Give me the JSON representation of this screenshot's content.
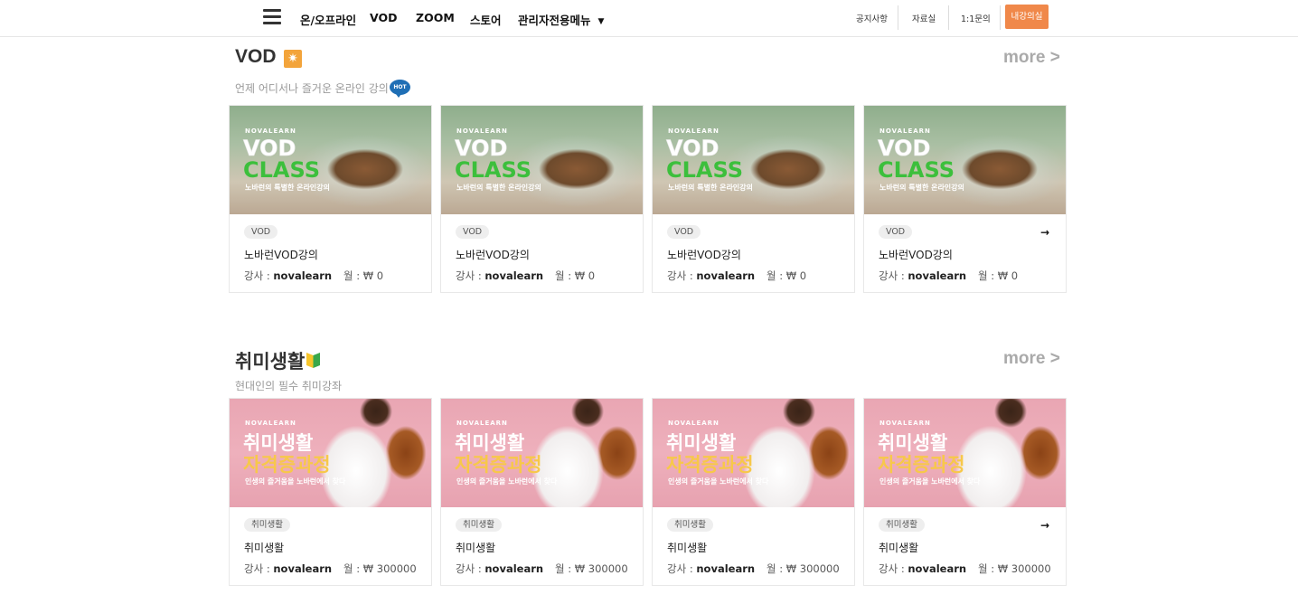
{
  "header": {
    "nav": [
      "온/오프라인",
      "VOD",
      "ZOOM",
      "스토어",
      "관리자전용메뉴"
    ],
    "utils": [
      "공지사항",
      "자료실",
      "1:1문의"
    ],
    "my_label": "내강의실"
  },
  "sections": [
    {
      "title": "VOD",
      "subtitle": "언제 어디서나 즐거운 온라인 강의",
      "hot_label": "HOT",
      "more_label": "more >",
      "thumb": {
        "brand": "NOVALEARN",
        "line1": "VOD",
        "line2": "CLASS",
        "tag": "노바런의 특별한 온라인강의"
      },
      "cards": [
        {
          "category": "VOD",
          "title": "노바런VOD강의",
          "instructor_label": "강사 : ",
          "instructor": "novalearn",
          "price": "월 : ₩ 0"
        },
        {
          "category": "VOD",
          "title": "노바런VOD강의",
          "instructor_label": "강사 : ",
          "instructor": "novalearn",
          "price": "월 : ₩ 0"
        },
        {
          "category": "VOD",
          "title": "노바런VOD강의",
          "instructor_label": "강사 : ",
          "instructor": "novalearn",
          "price": "월 : ₩ 0"
        },
        {
          "category": "VOD",
          "title": "노바런VOD강의",
          "instructor_label": "강사 : ",
          "instructor": "novalearn",
          "price": "월 : ₩ 0"
        }
      ]
    },
    {
      "title": "취미생활",
      "subtitle": "현대인의 필수 취미강좌",
      "more_label": "more >",
      "thumb": {
        "brand": "NOVALEARN",
        "line1": "취미생활",
        "line2": "자격증과정",
        "tag": "인생의 즐거움을 노바런에서 찾다"
      },
      "cards": [
        {
          "category": "취미생활",
          "title": "취미생활",
          "instructor_label": "강사 : ",
          "instructor": "novalearn",
          "price": "월 : ₩ 300000"
        },
        {
          "category": "취미생활",
          "title": "취미생활",
          "instructor_label": "강사 : ",
          "instructor": "novalearn",
          "price": "월 : ₩ 300000"
        },
        {
          "category": "취미생활",
          "title": "취미생활",
          "instructor_label": "강사 : ",
          "instructor": "novalearn",
          "price": "월 : ₩ 300000"
        },
        {
          "category": "취미생활",
          "title": "취미생활",
          "instructor_label": "강사 : ",
          "instructor": "novalearn",
          "price": "월 : ₩ 300000"
        }
      ]
    }
  ],
  "icons": {
    "menu": "hamburger-menu-icon",
    "caret": "caret-down-icon",
    "vod_badge": "star-badge-icon",
    "hobby_badge": "beginner-leaf-icon",
    "card_arrow": "arrow-right-icon"
  },
  "colors": {
    "accent": "#f0884a",
    "hot": "#1f6fb5",
    "vod_green": "#3cbf3c",
    "hobby_yellow": "#f7c84a",
    "more_gray": "#aaaaaa"
  }
}
